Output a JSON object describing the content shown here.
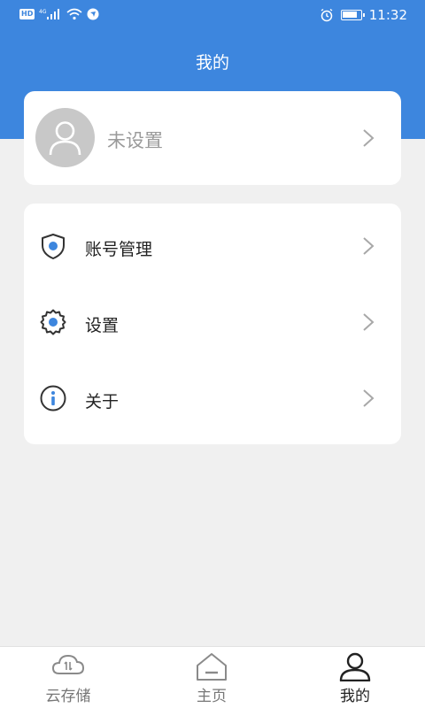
{
  "status_bar": {
    "hd_badge": "HD",
    "network": "4G",
    "time": "11:32",
    "battery_level": 0.85
  },
  "header": {
    "title": "我的"
  },
  "profile": {
    "name": "未设置"
  },
  "menu": {
    "items": [
      {
        "label": "账号管理",
        "icon": "shield-icon"
      },
      {
        "label": "设置",
        "icon": "gear-icon"
      },
      {
        "label": "关于",
        "icon": "info-icon"
      }
    ]
  },
  "bottom_nav": {
    "items": [
      {
        "label": "云存储",
        "icon": "cloud-icon",
        "active": false
      },
      {
        "label": "主页",
        "icon": "home-icon",
        "active": false
      },
      {
        "label": "我的",
        "icon": "person-icon",
        "active": true
      }
    ]
  },
  "colors": {
    "primary": "#3d86de",
    "background": "#f0f0f0",
    "inactive": "#777777",
    "active": "#222222"
  }
}
